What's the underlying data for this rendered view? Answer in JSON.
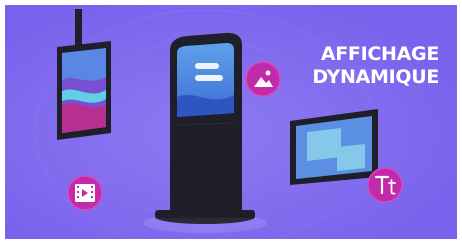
{
  "headline": {
    "line1": "AFFICHAGE",
    "line2": "DYNAMIQUE"
  },
  "icons": [
    "image-icon",
    "video-film-icon",
    "text-type-icon"
  ],
  "colors": {
    "background": "#7a63ec",
    "device_body": "#1f1f2a",
    "screen_blue": "#4a8be0",
    "icon_badge": "#c12aa9",
    "accent_pink": "#b8308f"
  }
}
